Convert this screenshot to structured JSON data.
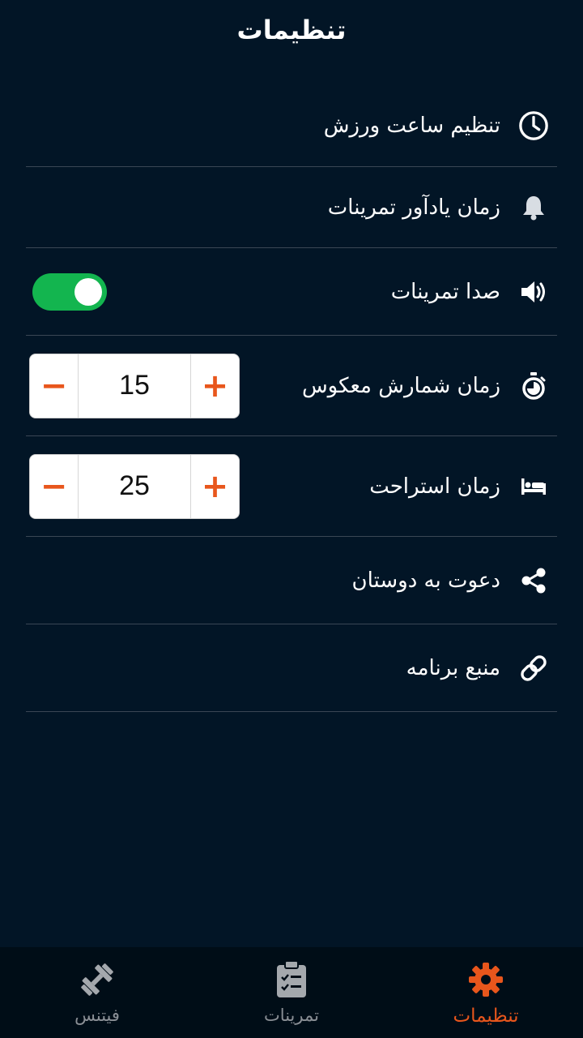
{
  "header": {
    "title": "تنظیمات"
  },
  "settings": {
    "workout_time": {
      "label": "تنظیم ساعت ورزش",
      "icon": "clock-icon"
    },
    "reminder": {
      "label": "زمان یادآور تمرینات",
      "icon": "bell-icon"
    },
    "sound": {
      "label": "صدا تمرینات",
      "icon": "speaker-icon",
      "enabled": true
    },
    "countdown": {
      "label": "زمان شمارش معکوس",
      "icon": "stopwatch-icon",
      "value": "15",
      "minus": "−",
      "plus": "+"
    },
    "rest": {
      "label": "زمان استراحت",
      "icon": "bed-icon",
      "value": "25",
      "minus": "−",
      "plus": "+"
    },
    "invite": {
      "label": "دعوت به دوستان",
      "icon": "share-icon"
    },
    "source": {
      "label": "منبع برنامه",
      "icon": "link-icon"
    }
  },
  "bottom_nav": {
    "items": [
      {
        "label": "فیتنس",
        "icon": "dumbbell-icon",
        "active": false
      },
      {
        "label": "تمرینات",
        "icon": "clipboard-icon",
        "active": false
      },
      {
        "label": "تنظیمات",
        "icon": "gear-icon",
        "active": true
      }
    ]
  },
  "colors": {
    "background": "#021526",
    "accent": "#e8561c",
    "toggle_on": "#13b54f",
    "divider": "#3a4654"
  }
}
